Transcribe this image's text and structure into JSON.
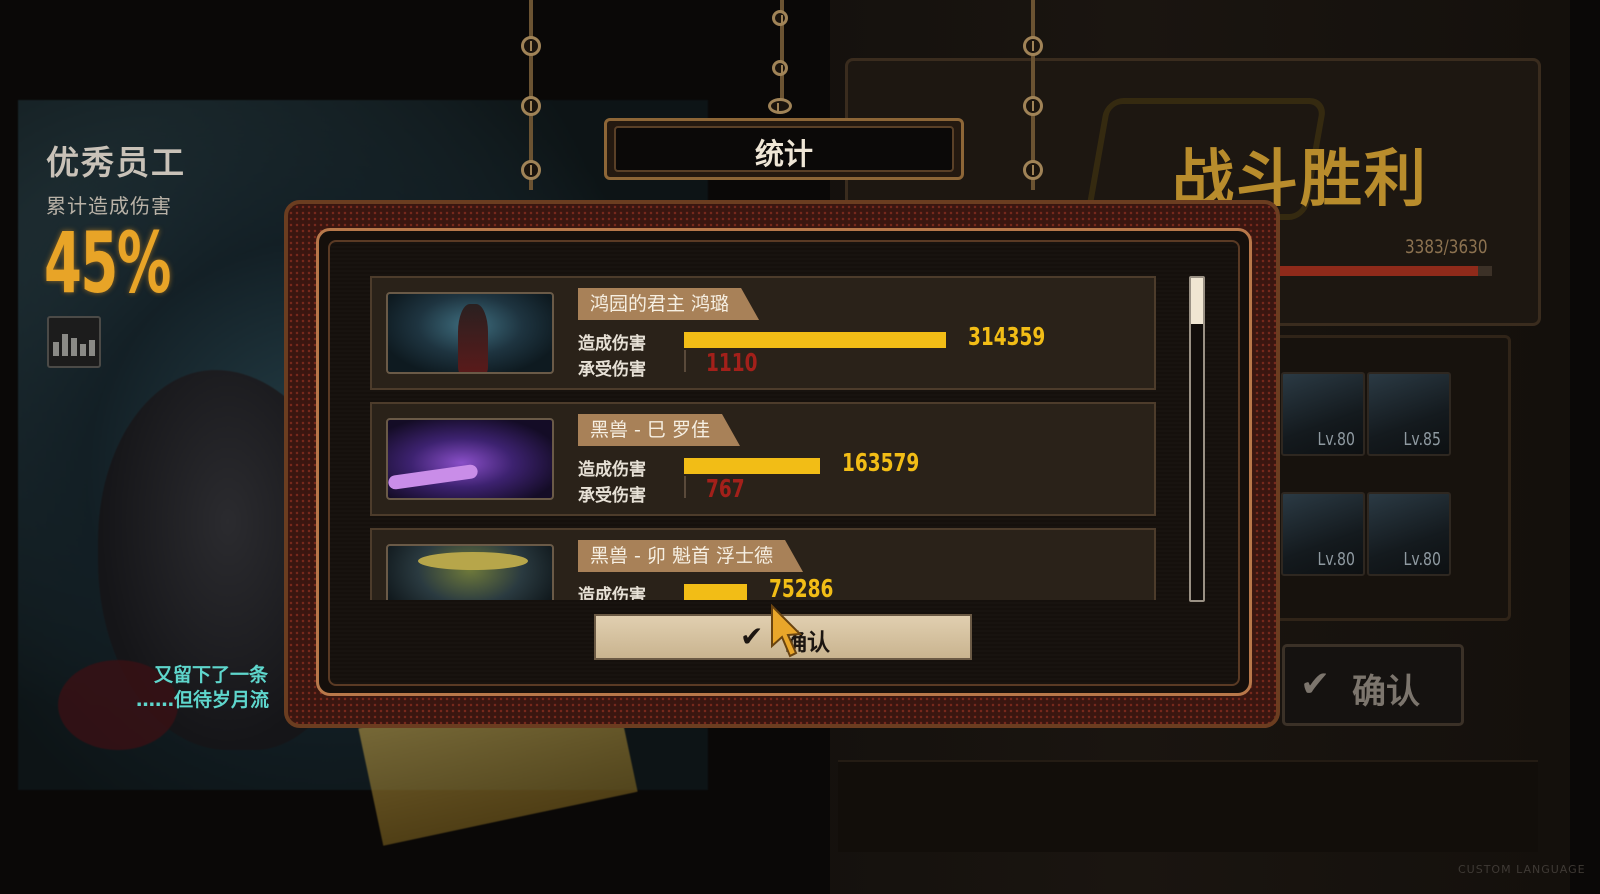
{
  "left_panel": {
    "title": "优秀员工",
    "subtitle": "累计造成伤害",
    "percent": "45%",
    "chart_icon": "bar-chart-icon",
    "quote_line1": "又留下了一条",
    "quote_line2": "……但待岁月流"
  },
  "right_panel": {
    "victory_title": "战斗胜利",
    "hp_text": "3383/3630",
    "hp_fraction": 0.932,
    "roster": [
      {
        "level": "Lv.80"
      },
      {
        "level": "Lv.85"
      },
      {
        "level": "Lv.80"
      },
      {
        "level": "Lv.80"
      }
    ],
    "confirm_label": "确认",
    "corner_text": "CUSTOM LANGUAGE"
  },
  "modal": {
    "title": "统计",
    "dealt_label": "造成伤害",
    "taken_label": "承受伤害",
    "confirm_label": "确认",
    "max_dealt": 314359,
    "rows": [
      {
        "name": "鸿园的君主 鸿璐",
        "dealt": "314359",
        "taken": "1110"
      },
      {
        "name": "黑兽 - 巳 罗佳",
        "dealt": "163579",
        "taken": "767"
      },
      {
        "name": "黑兽 - 卯 魁首 浮士德",
        "dealt": "75286",
        "taken": ""
      }
    ]
  },
  "colors": {
    "accent_gold": "#f2bd16",
    "damage_taken_red": "#a3201a",
    "frame_copper": "#b8784a",
    "quote_teal": "#5ed6cc"
  }
}
